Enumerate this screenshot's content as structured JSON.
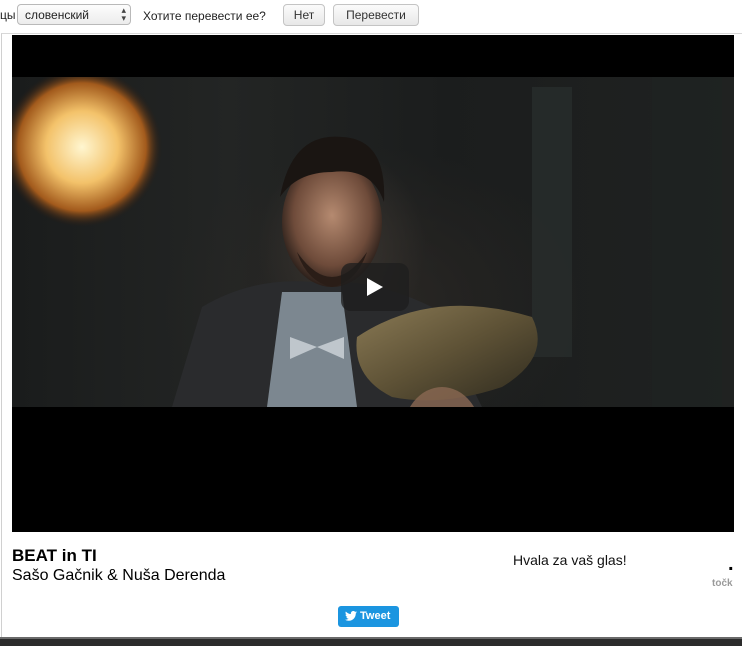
{
  "translate_bar": {
    "cut_label": "цы",
    "language_selected": "словенский",
    "question": "Хотите перевести ее?",
    "no_button": "Нет",
    "translate_button": "Перевести"
  },
  "video": {
    "play_icon": "play-icon"
  },
  "song": {
    "title": "BEAT in TI",
    "artist": "Sašo Gačnik & Nuša Derenda"
  },
  "vote": {
    "thanks": "Hvala za vaš glas!",
    "points_value": ".",
    "points_label": "točk"
  },
  "share": {
    "tweet_label": "Tweet",
    "tweet_icon": "twitter-bird-icon",
    "tweet_color": "#1b95e0"
  }
}
